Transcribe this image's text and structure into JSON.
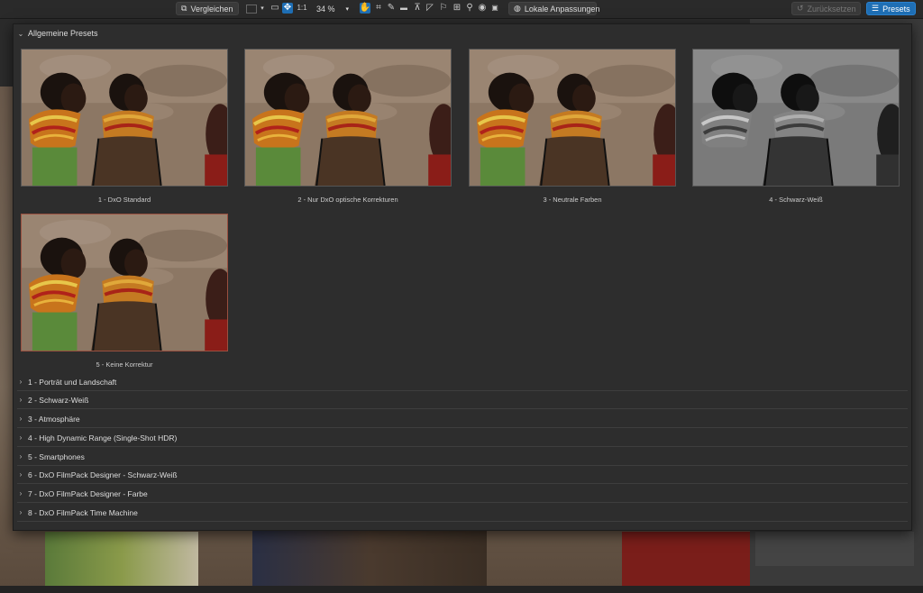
{
  "toolbar": {
    "compare_label": "Vergleichen",
    "one_to_one_label": "1:1",
    "zoom_value": "34 %",
    "local_adjust_label": "Lokale Anpassungen",
    "reset_label": "Zurücksetzen",
    "presets_label": "Presets"
  },
  "panel": {
    "section_title": "Allgemeine Presets",
    "thumbnails": [
      {
        "label": "1 - DxO Standard"
      },
      {
        "label": "2 - Nur DxO optische Korrekturen"
      },
      {
        "label": "3 - Neutrale Farben"
      },
      {
        "label": "4 - Schwarz-Weiß"
      },
      {
        "label": "5 - Keine Korrektur"
      }
    ],
    "groups": [
      "1 - Porträt und Landschaft",
      "2 - Schwarz-Weiß",
      "3 - Atmosphäre",
      "4 - High Dynamic Range (Single-Shot HDR)",
      "5 - Smartphones",
      "6 - DxO FilmPack Designer - Schwarz-Weiß",
      "7 - DxO FilmPack Designer - Farbe",
      "8 - DxO FilmPack Time Machine"
    ]
  },
  "colors": {
    "accent": "#1f6fb5",
    "panel_bg": "#2d2d2d"
  }
}
